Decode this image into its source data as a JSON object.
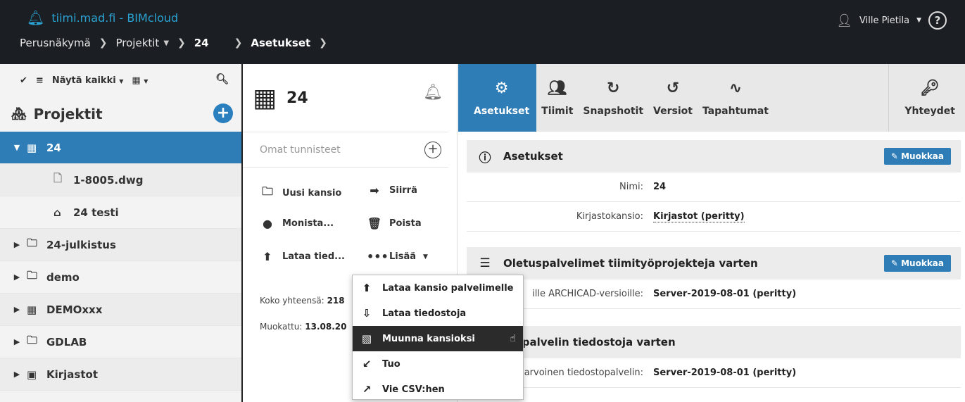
{
  "header": {
    "brand": "tiimi.mad.fi - BIMcloud",
    "breadcrumb": [
      "Perusnäkymä",
      "Projektit",
      "24",
      "Asetukset"
    ],
    "user": "Ville Pietila",
    "help": "?"
  },
  "sidebar": {
    "toolbar_filter": "Näytä kaikki",
    "title": "Projektit",
    "items": [
      {
        "label": "24",
        "type": "building",
        "active": true
      },
      {
        "label": "1-8005.dwg",
        "type": "file"
      },
      {
        "label": "24 testi",
        "type": "house"
      },
      {
        "label": "24-julkistus",
        "type": "folder"
      },
      {
        "label": "demo",
        "type": "folder"
      },
      {
        "label": "DEMOxxx",
        "type": "building"
      },
      {
        "label": "GDLAB",
        "type": "folder"
      },
      {
        "label": "Kirjastot",
        "type": "library"
      }
    ]
  },
  "middle": {
    "title": "24",
    "tags_placeholder": "Omat tunnisteet",
    "actions": {
      "new_folder": "Uusi kansio",
      "move": "Siirrä",
      "duplicate": "Monista...",
      "delete": "Poista",
      "upload": "Lataa tied...",
      "more": "Lisää"
    },
    "size_label": "Koko yhteensä:",
    "size_value": "218",
    "modified_label": "Muokattu:",
    "modified_value": "13.08.20"
  },
  "menu": {
    "items": [
      "Lataa kansio palvelimelle",
      "Lataa tiedostoja",
      "Muunna kansioksi",
      "Tuo",
      "Vie CSV:hen"
    ]
  },
  "tabs": {
    "settings": "Asetukset",
    "teams": "Tiimit",
    "snapshots": "Snapshotit",
    "versions": "Versiot",
    "events": "Tapahtumat",
    "connections": "Yhteydet"
  },
  "settings": {
    "title": "Asetukset",
    "edit": "Muokkaa",
    "name_label": "Nimi:",
    "name_value": "24",
    "library_label": "Kirjastokansio:",
    "library_value": "Kirjastot (peritty)"
  },
  "servers": {
    "title": "Oletuspalvelimet tiimityöprojekteja varten",
    "edit": "Muokkaa",
    "row_label": "ille ARCHICAD-versioille:",
    "row_value": "Server-2019-08-01 (peritty)"
  },
  "fileserver": {
    "title": "tuspalvelin tiedostoja varten",
    "row_label": "arvoinen tiedostopalvelin:",
    "row_value": "Server-2019-08-01 (peritty)"
  }
}
